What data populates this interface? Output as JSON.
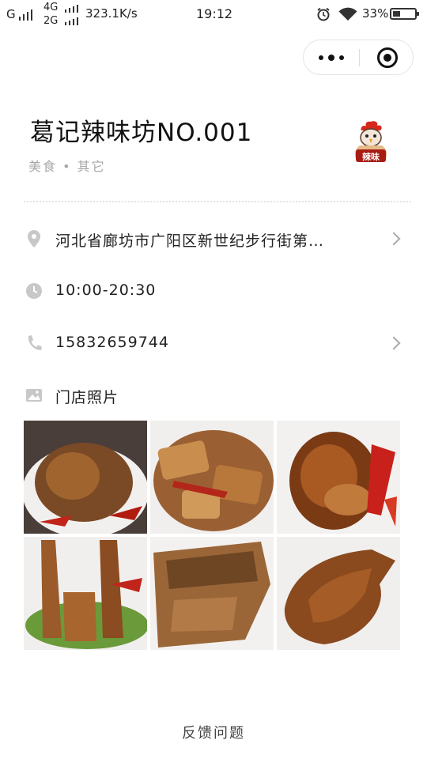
{
  "status_bar": {
    "carrier1": "G",
    "net_a": "4G",
    "net_b": "2G",
    "speed": "323.1K/s",
    "time": "19:12",
    "battery": "33%",
    "battery_level": 0.33
  },
  "shop": {
    "name": "葛记辣味坊NO.001",
    "category": "美食 • 其它",
    "logo_text": "辣味"
  },
  "info": {
    "address": "河北省廊坊市广阳区新世纪步行街第…",
    "hours": "10:00-20:30",
    "phone": "15832659744",
    "photos_label": "门店照片"
  },
  "photos": [
    "roast-duck-platter",
    "tofu-and-chili",
    "braised-trotter",
    "duck-necks",
    "braised-duck-slices",
    "whole-braised-duck"
  ],
  "footer": {
    "feedback": "反馈问题"
  }
}
